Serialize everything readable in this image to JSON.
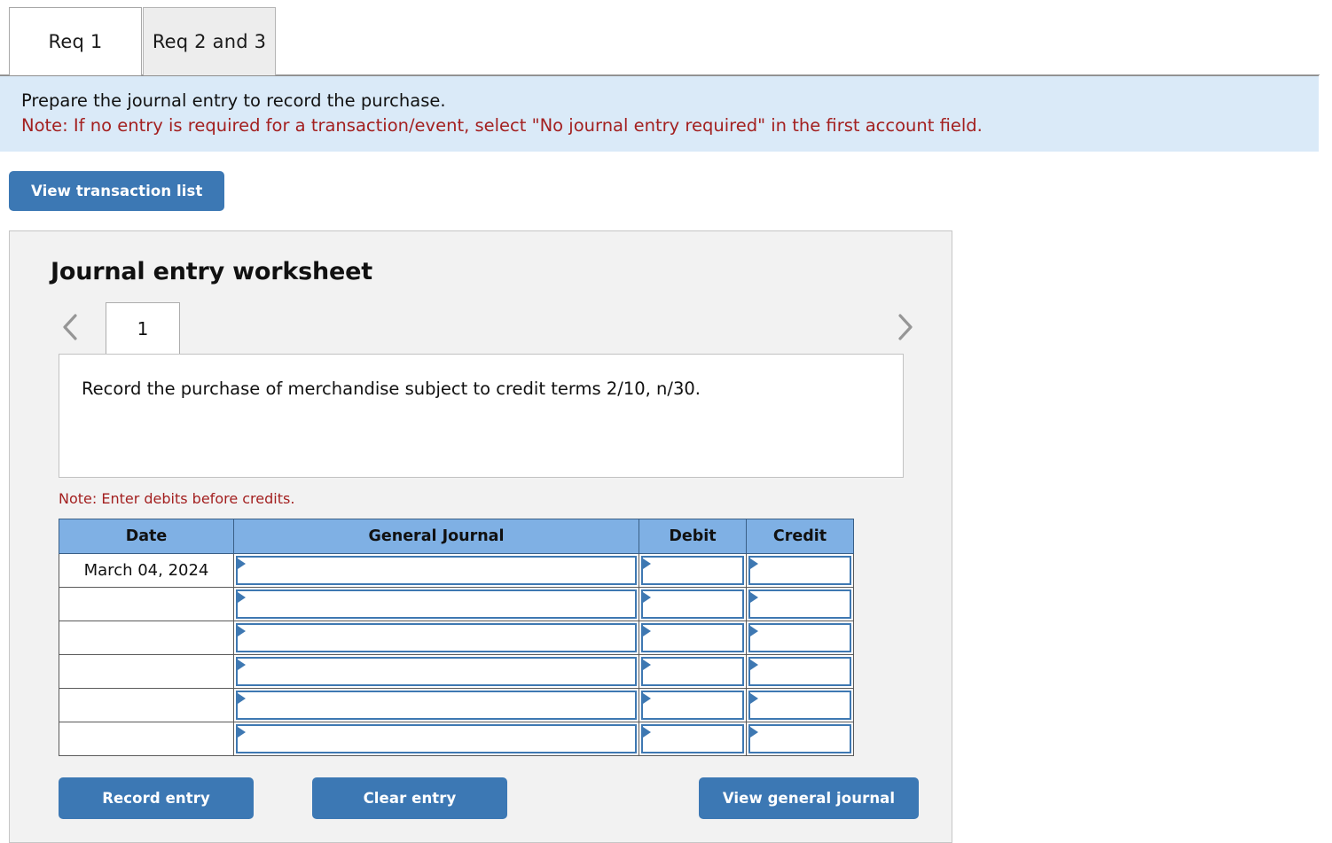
{
  "tabs": [
    {
      "label": "Req 1",
      "active": true
    },
    {
      "label": "Req 2 and 3",
      "active": false
    }
  ],
  "banner": {
    "instruction": "Prepare the journal entry to record the purchase.",
    "note": "Note: If no entry is required for a transaction/event, select \"No journal entry required\" in the first account field."
  },
  "toolbar": {
    "view_transaction_list_label": "View transaction list"
  },
  "worksheet": {
    "title": "Journal entry worksheet",
    "pager": {
      "prev_icon": "chevron-left-icon",
      "next_icon": "chevron-right-icon",
      "current_page": "1"
    },
    "description": "Record the purchase of merchandise subject to credit terms 2/10, n/30.",
    "note_debits": "Note: Enter debits before credits.",
    "table": {
      "headers": [
        "Date",
        "General Journal",
        "Debit",
        "Credit"
      ],
      "rows": [
        {
          "date": "March 04, 2024",
          "general_journal": "",
          "debit": "",
          "credit": ""
        },
        {
          "date": "",
          "general_journal": "",
          "debit": "",
          "credit": ""
        },
        {
          "date": "",
          "general_journal": "",
          "debit": "",
          "credit": ""
        },
        {
          "date": "",
          "general_journal": "",
          "debit": "",
          "credit": ""
        },
        {
          "date": "",
          "general_journal": "",
          "debit": "",
          "credit": ""
        },
        {
          "date": "",
          "general_journal": "",
          "debit": "",
          "credit": ""
        }
      ]
    },
    "buttons": {
      "record_entry_label": "Record entry",
      "clear_entry_label": "Clear entry",
      "view_general_journal_label": "View general journal"
    }
  },
  "colors": {
    "button_blue": "#3c78b4",
    "table_header_blue": "#7fb0e4",
    "banner_blue": "#daeaf8",
    "note_red": "#a32020",
    "panel_grey": "#f2f2f2",
    "field_border_blue": "#3e78b2"
  }
}
